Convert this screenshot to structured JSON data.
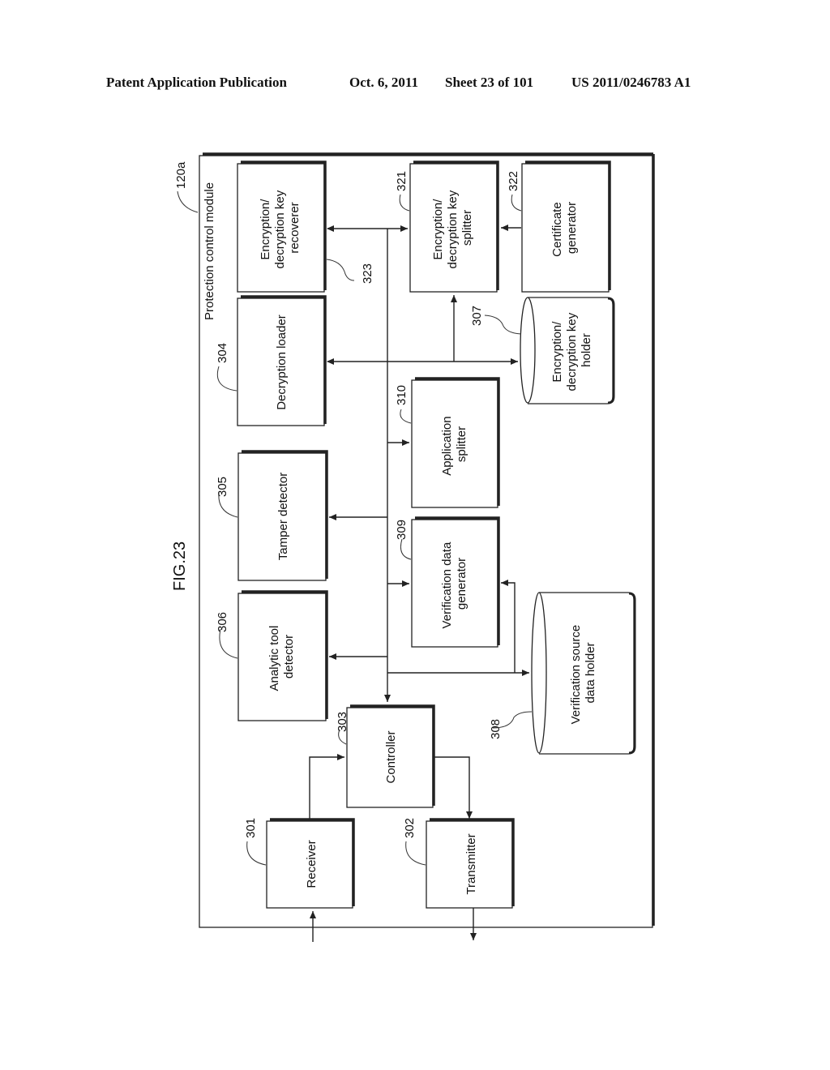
{
  "header": {
    "publication": "Patent Application Publication",
    "date": "Oct. 6, 2011",
    "sheet": "Sheet 23 of 101",
    "number": "US 2011/0246783 A1"
  },
  "figure": {
    "label": "FIG.23",
    "module_ref": "120a",
    "module_title": "Protection control module"
  },
  "blocks": {
    "key_recoverer": {
      "ref": "323",
      "lines": [
        "Encryption/",
        "decryption key",
        "recoverer"
      ]
    },
    "key_splitter": {
      "ref": "321",
      "lines": [
        "Encryption/",
        "decryption key",
        "splitter"
      ]
    },
    "cert_generator": {
      "ref": "322",
      "lines": [
        "Certificate",
        "generator"
      ]
    },
    "decrypt_loader": {
      "ref": "304",
      "lines": [
        "Decryption loader"
      ]
    },
    "key_holder": {
      "ref": "307",
      "lines": [
        "Encryption/",
        "decryption key",
        "holder"
      ]
    },
    "app_splitter": {
      "ref": "310",
      "lines": [
        "Application",
        "splitter"
      ]
    },
    "tamper_detector": {
      "ref": "305",
      "lines": [
        "Tamper detector"
      ]
    },
    "verif_generator": {
      "ref": "309",
      "lines": [
        "Verification data",
        "generator"
      ]
    },
    "analytic_detector": {
      "ref": "306",
      "lines": [
        "Analytic tool",
        "detector"
      ]
    },
    "verif_holder": {
      "ref": "308",
      "lines": [
        "Verification source",
        "data holder"
      ]
    },
    "controller": {
      "ref": "303",
      "lines": [
        "Controller"
      ]
    },
    "receiver": {
      "ref": "301",
      "lines": [
        "Receiver"
      ]
    },
    "transmitter": {
      "ref": "302",
      "lines": [
        "Transmitter"
      ]
    }
  }
}
